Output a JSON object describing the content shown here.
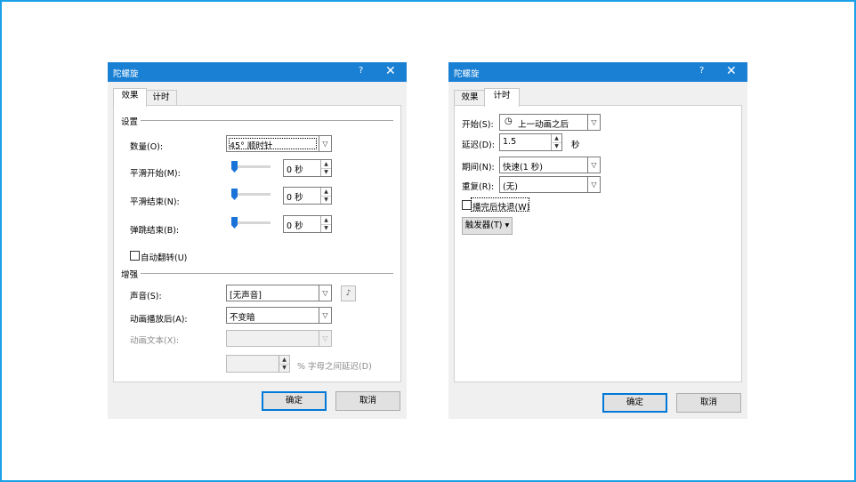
{
  "left_dialog": {
    "title": "陀螺旋",
    "help": "?",
    "close": "✕",
    "tabs": [
      {
        "label": "效果",
        "active": true
      },
      {
        "label": "计时",
        "active": false
      }
    ],
    "settings_section": "设置",
    "amount_label": "数量(O):",
    "amount_value": "45° 顺时针",
    "smooth_start_label": "平滑开始(M):",
    "smooth_start_value": "0 秒",
    "smooth_end_label": "平滑结束(N):",
    "smooth_end_value": "0 秒",
    "bounce_end_label": "弹跳结束(B):",
    "bounce_end_value": "0 秒",
    "auto_reverse_label": "自动翻转(U)",
    "auto_reverse_checked": false,
    "enhance_section": "增强",
    "sound_label": "声音(S):",
    "sound_value": "[无声音]",
    "after_anim_label": "动画播放后(A):",
    "after_anim_value": "不变暗",
    "anim_text_label": "动画文本(X):",
    "anim_text_value": "",
    "delay_pct_label": "% 字母之间延迟(D)",
    "delay_pct_value": "",
    "ok": "确定",
    "cancel": "取消"
  },
  "right_dialog": {
    "title": "陀螺旋",
    "help": "?",
    "close": "✕",
    "tabs": [
      {
        "label": "效果",
        "active": false
      },
      {
        "label": "计时",
        "active": true
      }
    ],
    "start_label": "开始(S):",
    "start_value": "上一动画之后",
    "delay_label": "延迟(D):",
    "delay_value": "1.5",
    "delay_unit": "秒",
    "duration_label": "期间(N):",
    "duration_value": "快速(1 秒)",
    "repeat_label": "重复(R):",
    "repeat_value": "(无)",
    "rewind_label": "播完后快退(W)",
    "rewind_checked": false,
    "triggers_label": "触发器(T) ▾",
    "ok": "确定",
    "cancel": "取消"
  },
  "colors": {
    "titlebar": "#1a80d4",
    "frame": "#1aa1e6",
    "slider_thumb": "#1a73d8"
  }
}
